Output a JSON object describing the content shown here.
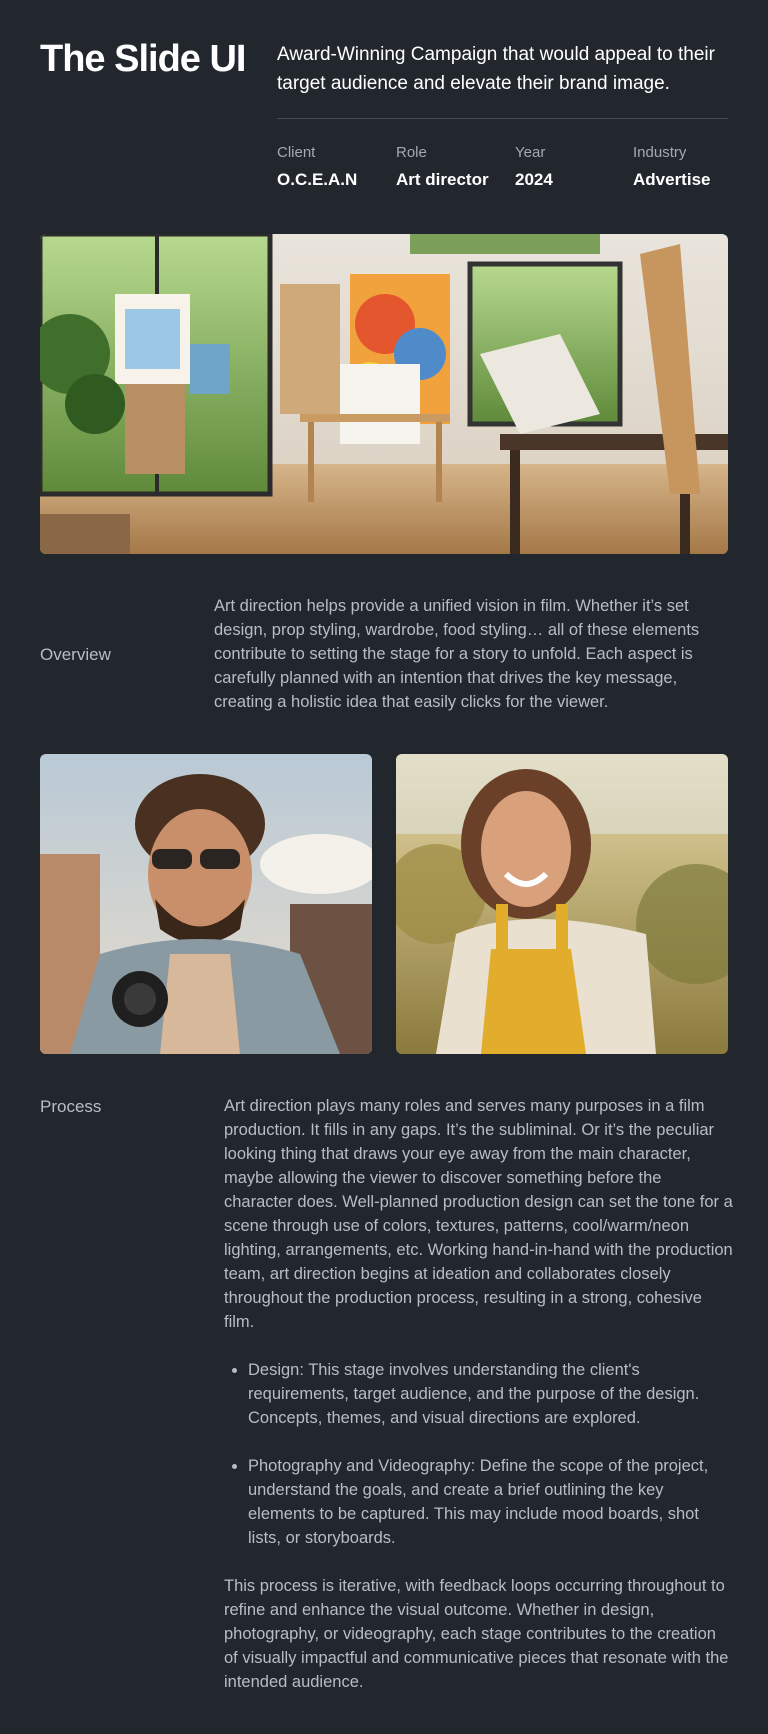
{
  "header": {
    "title": "The Slide UI",
    "tagline": "Award-Winning Campaign that would appeal to their target audience and elevate their brand image."
  },
  "meta": [
    {
      "label": "Client",
      "value": "O.C.E.A.N"
    },
    {
      "label": "Role",
      "value": "Art director"
    },
    {
      "label": "Year",
      "value": "2024"
    },
    {
      "label": "Industry",
      "value": "Advertise"
    }
  ],
  "overview": {
    "label": "Overview",
    "text": "Art direction helps provide a unified vision in film. Whether it’s set design, prop styling, wardrobe, food styling… all of these elements contribute to setting the stage for a story to unfold. Each aspect is carefully planned with an intention that drives the key message, creating a holistic idea that easily clicks for the viewer."
  },
  "process": {
    "label": "Process",
    "intro": "Art direction plays many roles and serves many purposes in a film production. It fills in any gaps. It’s the subliminal. Or it’s the peculiar looking thing that draws your eye away from the main character, maybe allowing the viewer to discover something before the character does. Well-planned production design can set the tone for a scene through use of colors, textures, patterns, cool/warm/neon lighting, arrangements, etc. Working hand-in-hand with the production team, art direction begins at ideation and collaborates closely throughout the production process, resulting in a strong, cohesive film.",
    "bullets": [
      "Design: This stage involves understanding the client's requirements, target audience, and the purpose of the design. Concepts, themes, and visual directions are explored.",
      "Photography and Videography: Define the scope of the project, understand the goals, and create a brief outlining the key elements to be captured. This may include mood boards, shot lists, or storyboards."
    ],
    "outro": "This process is iterative, with feedback loops occurring throughout to refine and enhance the visual outcome. Whether in design, photography, or videography, each stage contributes to the creation of visually impactful and communicative pieces that resonate with the intended audience."
  },
  "colors": {
    "background": "#22272e",
    "text": "#b9bdc3",
    "heading": "#ffffff"
  }
}
